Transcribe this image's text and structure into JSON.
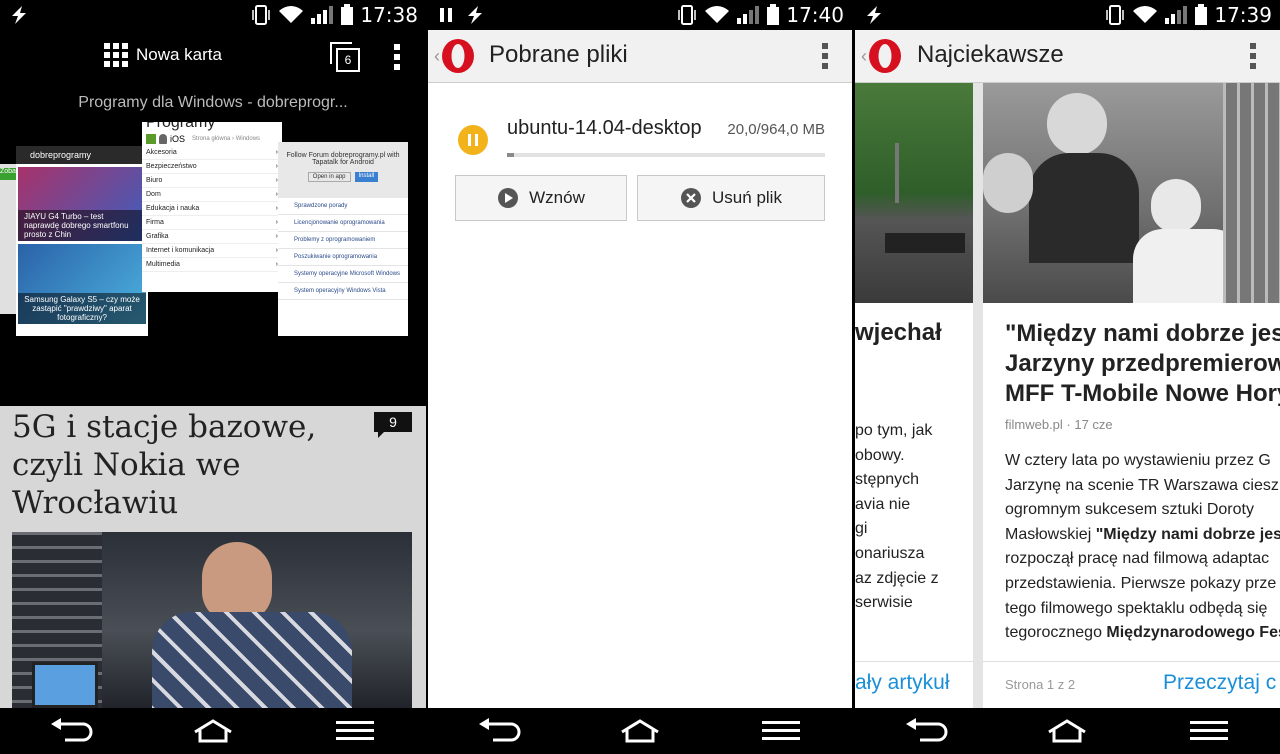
{
  "status": {
    "p1_time": "17:38",
    "p2_time": "17:40",
    "p3_time": "17:39"
  },
  "panel1": {
    "tabbar_title": "Nowa karta",
    "tab_count": "6",
    "tab_title": "Programy dla Windows - dobreprogr...",
    "thumb_left": {
      "logo": "dobreprogramy",
      "item1": "JIAYU G4 Turbo – test naprawdę dobrego smartfonu prosto z Chin",
      "item2": "Samsung Galaxy S5 – czy może zastąpić \"prawdziwy\" aparat fotograficzny?",
      "badge": "Zobacz, co"
    },
    "thumb_menu": {
      "title": "Programy",
      "crumb": "Strona główna › Windows",
      "ios": "iOS",
      "items": [
        "Akcesoria",
        "Bezpieczeństwo",
        "Biuro",
        "Dom",
        "Edukacja i nauka",
        "Firma",
        "Grafika",
        "Internet i komunikacja",
        "Multimedia"
      ]
    },
    "thumb_forum": {
      "promo": "Follow Forum dobreprogramy.pl with Tapatalk for Android",
      "open": "Open in app",
      "install": "Install",
      "items": [
        "Sprawdzone porady",
        "Licencjonowanie oprogramowania",
        "Problemy z oprogramowaniem",
        "Poszukiwanie oprogramowania",
        "Systemy operacyjne Microsoft Windows",
        "System operacyjny Windows Vista"
      ]
    },
    "article_title": "5G i stacje bazowe, czyli Nokia we Wrocławiu",
    "comment_count": "9"
  },
  "panel2": {
    "title": "Pobrane pliki",
    "file_name": "ubuntu-14.04-desktop",
    "file_size": "20,0/964,0 MB",
    "progress": 0.021,
    "resume_label": "Wznów",
    "delete_label": "Usuń plik"
  },
  "panel3": {
    "title": "Najciekawsze",
    "left_card": {
      "title_fragment": "wjechał",
      "lines": [
        "po tym, jak",
        "obowy.",
        "stępnych",
        "avia nie",
        "gi",
        "onariusza",
        "az zdjęcie z",
        "serwisie"
      ],
      "link": "ały artykuł"
    },
    "right_card": {
      "title": "\"Między nami dobrze jes Jarzyny przedpremierow MFF T-Mobile Nowe Hory",
      "source": "filmweb.pl · 17 cze",
      "body_lines": [
        {
          "t": "W cztery lata po wystawieniu przez G"
        },
        {
          "t": "Jarzynę na scenie TR Warszawa ciesz"
        },
        {
          "t": "ogromnym sukcesem sztuki Doroty"
        },
        {
          "t": "Masłowskiej ",
          "b": "\"Między nami dobrze jes"
        },
        {
          "t": "rozpoczął pracę nad filmową adaptac"
        },
        {
          "t": "przedstawienia. Pierwsze pokazy prze"
        },
        {
          "t": "tego filmowego spektaklu odbędą się"
        },
        {
          "t": "tegorocznego ",
          "b": "Międzynarodowego Fes"
        }
      ],
      "page": "Strona 1 z 2",
      "read": "Przeczytaj c"
    }
  },
  "colors": {
    "opera_red": "#d6101f",
    "pause_yellow": "#f2b21a",
    "link_blue": "#1a8fd8"
  }
}
